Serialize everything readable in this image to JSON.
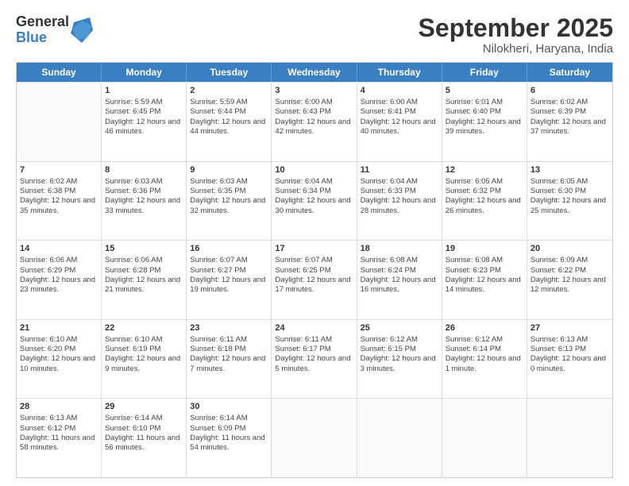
{
  "logo": {
    "general": "General",
    "blue": "Blue"
  },
  "title": {
    "month": "September 2025",
    "location": "Nilokheri, Haryana, India"
  },
  "header_days": [
    "Sunday",
    "Monday",
    "Tuesday",
    "Wednesday",
    "Thursday",
    "Friday",
    "Saturday"
  ],
  "weeks": [
    [
      {
        "day": "",
        "sunrise": "",
        "sunset": "",
        "daylight": ""
      },
      {
        "day": "1",
        "sunrise": "Sunrise: 5:59 AM",
        "sunset": "Sunset: 6:45 PM",
        "daylight": "Daylight: 12 hours and 46 minutes."
      },
      {
        "day": "2",
        "sunrise": "Sunrise: 5:59 AM",
        "sunset": "Sunset: 6:44 PM",
        "daylight": "Daylight: 12 hours and 44 minutes."
      },
      {
        "day": "3",
        "sunrise": "Sunrise: 6:00 AM",
        "sunset": "Sunset: 6:43 PM",
        "daylight": "Daylight: 12 hours and 42 minutes."
      },
      {
        "day": "4",
        "sunrise": "Sunrise: 6:00 AM",
        "sunset": "Sunset: 6:41 PM",
        "daylight": "Daylight: 12 hours and 40 minutes."
      },
      {
        "day": "5",
        "sunrise": "Sunrise: 6:01 AM",
        "sunset": "Sunset: 6:40 PM",
        "daylight": "Daylight: 12 hours and 39 minutes."
      },
      {
        "day": "6",
        "sunrise": "Sunrise: 6:02 AM",
        "sunset": "Sunset: 6:39 PM",
        "daylight": "Daylight: 12 hours and 37 minutes."
      }
    ],
    [
      {
        "day": "7",
        "sunrise": "Sunrise: 6:02 AM",
        "sunset": "Sunset: 6:38 PM",
        "daylight": "Daylight: 12 hours and 35 minutes."
      },
      {
        "day": "8",
        "sunrise": "Sunrise: 6:03 AM",
        "sunset": "Sunset: 6:36 PM",
        "daylight": "Daylight: 12 hours and 33 minutes."
      },
      {
        "day": "9",
        "sunrise": "Sunrise: 6:03 AM",
        "sunset": "Sunset: 6:35 PM",
        "daylight": "Daylight: 12 hours and 32 minutes."
      },
      {
        "day": "10",
        "sunrise": "Sunrise: 6:04 AM",
        "sunset": "Sunset: 6:34 PM",
        "daylight": "Daylight: 12 hours and 30 minutes."
      },
      {
        "day": "11",
        "sunrise": "Sunrise: 6:04 AM",
        "sunset": "Sunset: 6:33 PM",
        "daylight": "Daylight: 12 hours and 28 minutes."
      },
      {
        "day": "12",
        "sunrise": "Sunrise: 6:05 AM",
        "sunset": "Sunset: 6:32 PM",
        "daylight": "Daylight: 12 hours and 26 minutes."
      },
      {
        "day": "13",
        "sunrise": "Sunrise: 6:05 AM",
        "sunset": "Sunset: 6:30 PM",
        "daylight": "Daylight: 12 hours and 25 minutes."
      }
    ],
    [
      {
        "day": "14",
        "sunrise": "Sunrise: 6:06 AM",
        "sunset": "Sunset: 6:29 PM",
        "daylight": "Daylight: 12 hours and 23 minutes."
      },
      {
        "day": "15",
        "sunrise": "Sunrise: 6:06 AM",
        "sunset": "Sunset: 6:28 PM",
        "daylight": "Daylight: 12 hours and 21 minutes."
      },
      {
        "day": "16",
        "sunrise": "Sunrise: 6:07 AM",
        "sunset": "Sunset: 6:27 PM",
        "daylight": "Daylight: 12 hours and 19 minutes."
      },
      {
        "day": "17",
        "sunrise": "Sunrise: 6:07 AM",
        "sunset": "Sunset: 6:25 PM",
        "daylight": "Daylight: 12 hours and 17 minutes."
      },
      {
        "day": "18",
        "sunrise": "Sunrise: 6:08 AM",
        "sunset": "Sunset: 6:24 PM",
        "daylight": "Daylight: 12 hours and 16 minutes."
      },
      {
        "day": "19",
        "sunrise": "Sunrise: 6:08 AM",
        "sunset": "Sunset: 6:23 PM",
        "daylight": "Daylight: 12 hours and 14 minutes."
      },
      {
        "day": "20",
        "sunrise": "Sunrise: 6:09 AM",
        "sunset": "Sunset: 6:22 PM",
        "daylight": "Daylight: 12 hours and 12 minutes."
      }
    ],
    [
      {
        "day": "21",
        "sunrise": "Sunrise: 6:10 AM",
        "sunset": "Sunset: 6:20 PM",
        "daylight": "Daylight: 12 hours and 10 minutes."
      },
      {
        "day": "22",
        "sunrise": "Sunrise: 6:10 AM",
        "sunset": "Sunset: 6:19 PM",
        "daylight": "Daylight: 12 hours and 9 minutes."
      },
      {
        "day": "23",
        "sunrise": "Sunrise: 6:11 AM",
        "sunset": "Sunset: 6:18 PM",
        "daylight": "Daylight: 12 hours and 7 minutes."
      },
      {
        "day": "24",
        "sunrise": "Sunrise: 6:11 AM",
        "sunset": "Sunset: 6:17 PM",
        "daylight": "Daylight: 12 hours and 5 minutes."
      },
      {
        "day": "25",
        "sunrise": "Sunrise: 6:12 AM",
        "sunset": "Sunset: 6:15 PM",
        "daylight": "Daylight: 12 hours and 3 minutes."
      },
      {
        "day": "26",
        "sunrise": "Sunrise: 6:12 AM",
        "sunset": "Sunset: 6:14 PM",
        "daylight": "Daylight: 12 hours and 1 minute."
      },
      {
        "day": "27",
        "sunrise": "Sunrise: 6:13 AM",
        "sunset": "Sunset: 6:13 PM",
        "daylight": "Daylight: 12 hours and 0 minutes."
      }
    ],
    [
      {
        "day": "28",
        "sunrise": "Sunrise: 6:13 AM",
        "sunset": "Sunset: 6:12 PM",
        "daylight": "Daylight: 11 hours and 58 minutes."
      },
      {
        "day": "29",
        "sunrise": "Sunrise: 6:14 AM",
        "sunset": "Sunset: 6:10 PM",
        "daylight": "Daylight: 11 hours and 56 minutes."
      },
      {
        "day": "30",
        "sunrise": "Sunrise: 6:14 AM",
        "sunset": "Sunset: 6:09 PM",
        "daylight": "Daylight: 11 hours and 54 minutes."
      },
      {
        "day": "",
        "sunrise": "",
        "sunset": "",
        "daylight": ""
      },
      {
        "day": "",
        "sunrise": "",
        "sunset": "",
        "daylight": ""
      },
      {
        "day": "",
        "sunrise": "",
        "sunset": "",
        "daylight": ""
      },
      {
        "day": "",
        "sunrise": "",
        "sunset": "",
        "daylight": ""
      }
    ]
  ]
}
